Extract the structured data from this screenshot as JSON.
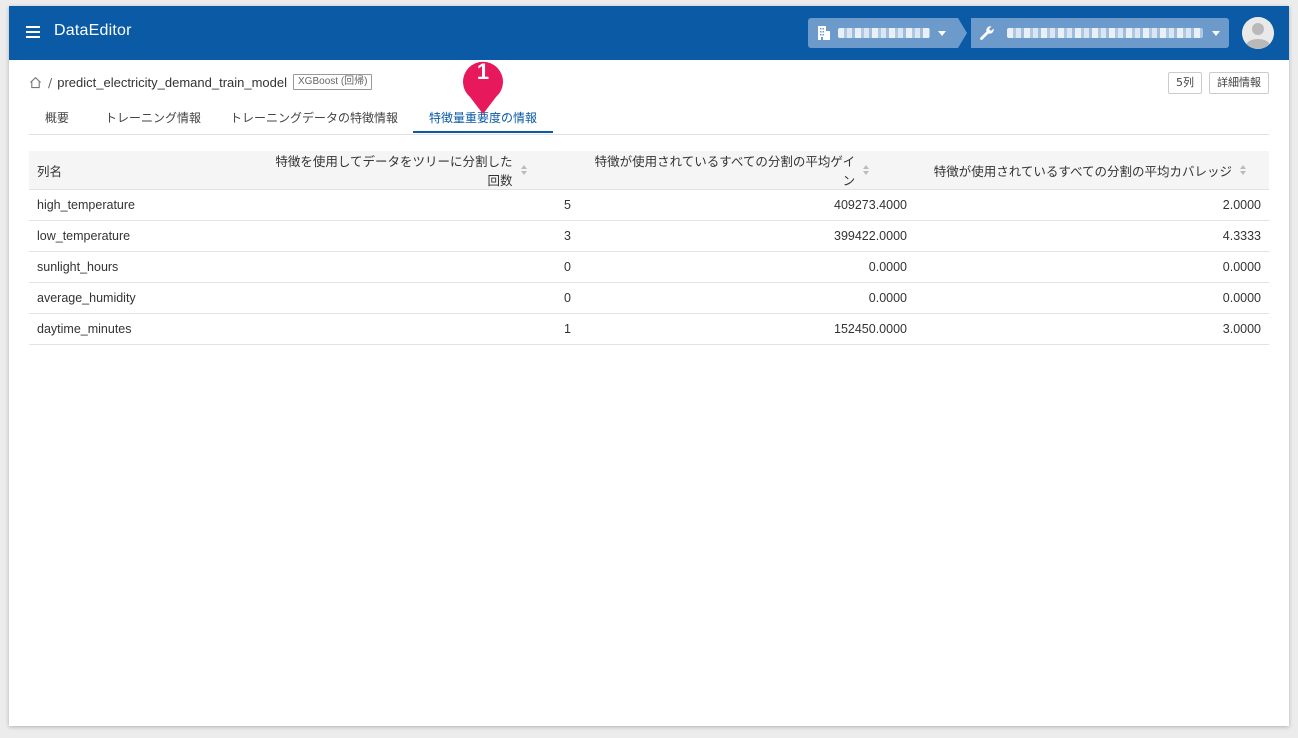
{
  "header": {
    "app_title": "DataEditor",
    "icons": {
      "menu": "hamburger-menu-icon",
      "org": "building-icon",
      "project": "wrench-icon",
      "avatar": "user-avatar-icon"
    }
  },
  "breadcrumb": {
    "separator": "/",
    "model_name": "predict_electricity_demand_train_model",
    "model_type": "XGBoost (回帰)"
  },
  "actions": {
    "columns_label": "5列",
    "details_label": "詳細情報"
  },
  "tabs": [
    {
      "label": "概要"
    },
    {
      "label": "トレーニング情報"
    },
    {
      "label": "トレーニングデータの特徴情報"
    },
    {
      "label": "特徴量重要度の情報"
    }
  ],
  "active_tab": 3,
  "marker": {
    "number": "1",
    "color": "#e8185c"
  },
  "table": {
    "headers": [
      "列名",
      "特徴を使用してデータをツリーに分割した回数",
      "特徴が使用されているすべての分割の平均ゲイン",
      "特徴が使用されているすべての分割の平均カバレッジ"
    ],
    "rows": [
      [
        "high_temperature",
        "5",
        "409273.4000",
        "2.0000"
      ],
      [
        "low_temperature",
        "3",
        "399422.0000",
        "4.3333"
      ],
      [
        "sunlight_hours",
        "0",
        "0.0000",
        "0.0000"
      ],
      [
        "average_humidity",
        "0",
        "0.0000",
        "0.0000"
      ],
      [
        "daytime_minutes",
        "1",
        "152450.0000",
        "3.0000"
      ]
    ]
  },
  "colors": {
    "primary": "#0a5aa5",
    "marker": "#e8185c",
    "header_bg": "#f5f5f5"
  }
}
